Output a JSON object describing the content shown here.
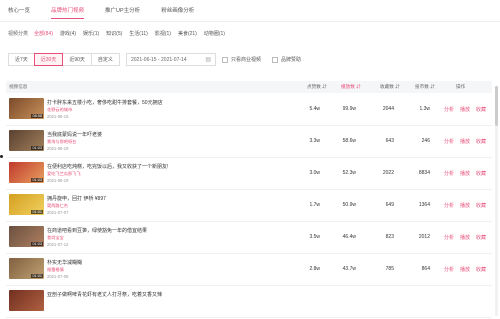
{
  "tabs": [
    "核心一览",
    "品牌热门视频",
    "推广UP主分析",
    "粉丝画像分析"
  ],
  "active_tab": 1,
  "filter": {
    "label": "视频分类",
    "options": [
      "全部(84)",
      "游戏(4)",
      "娱乐(1)",
      "知识(5)",
      "生活(11)",
      "影视(1)",
      "美食(21)",
      "动物圈(1)"
    ],
    "active": 0
  },
  "date_options": [
    "近7天",
    "近30天",
    "近90天",
    "自定义"
  ],
  "active_date": 1,
  "date_range": "2021-06-15  -  2021-07-14",
  "calendar_icon": "calendar-icon",
  "checkboxes": [
    "只看商业视频",
    "品牌赞助"
  ],
  "columns": [
    "视频信息",
    "点赞数",
    "播放数",
    "收藏数",
    "投币数",
    "操作"
  ],
  "accent_color": "#e8507a",
  "rows": [
    {
      "title": "打卡胖东来五楼小吃，奢侈吃甜牛排套餐，50元拥店",
      "author": "花野云的城市",
      "date": "2021-06-15",
      "duration": "08:58",
      "likes": "5.4w",
      "plays": "99.9w",
      "favs": "2044",
      "coins": "1.3w",
      "thumb": [
        "#7a4a2a",
        "#c9925a"
      ]
    },
    {
      "title": "当我底蒙妈说一年吓老婆",
      "author": "景淘与那吧呀台",
      "date": "2021-06-19",
      "duration": "01:03",
      "likes": "3.3w",
      "plays": "58.6w",
      "favs": "643",
      "coins": "246",
      "thumb": [
        "#5a4030",
        "#a0805a"
      ]
    },
    {
      "title": "在便利店吃炖糕，吃完饭以后，我又收获了一个新朋友!",
      "author": "爱吃飞兰瓜那飞飞",
      "date": "2021-06-19",
      "duration": "01:03",
      "likes": "3.0w",
      "plays": "52.3w",
      "favs": "2022",
      "coins": "8834",
      "thumb": [
        "#c0392b",
        "#e8a060"
      ]
    },
    {
      "title": "拥丹旋申，回打 伊桥 ¥897",
      "author": "箴两路仁杰",
      "date": "2021-07-07",
      "duration": "01:01",
      "likes": "1.7w",
      "plays": "50.9w",
      "favs": "649",
      "coins": "1364",
      "thumb": [
        "#d4a020",
        "#f0d060"
      ]
    },
    {
      "title": "在商道吧看到豆笋，绿使豁免一年的借宜结果",
      "author": "食尚宝宝",
      "date": "2021-07-12",
      "duration": "01:03",
      "likes": "3.5w",
      "plays": "46.4w",
      "favs": "823",
      "coins": "2012",
      "thumb": [
        "#6a5040",
        "#b08060"
      ]
    },
    {
      "title": "朴实无华减糊糊",
      "author": "格雷格情",
      "date": "2021-07-06",
      "duration": "01:01",
      "likes": "2.8w",
      "plays": "43.7w",
      "favs": "785",
      "coins": "864",
      "thumb": [
        "#806040",
        "#c0a070"
      ]
    },
    {
      "title": "亚剖子做啊啤青花虾有老丈人打牙祭，吃着又香又辣",
      "author": "",
      "date": "",
      "duration": "",
      "likes": "",
      "plays": "",
      "favs": "",
      "coins": "",
      "thumb": [
        "#703020",
        "#b06040"
      ]
    }
  ],
  "row_actions": [
    "分析",
    "播放",
    "收藏"
  ]
}
